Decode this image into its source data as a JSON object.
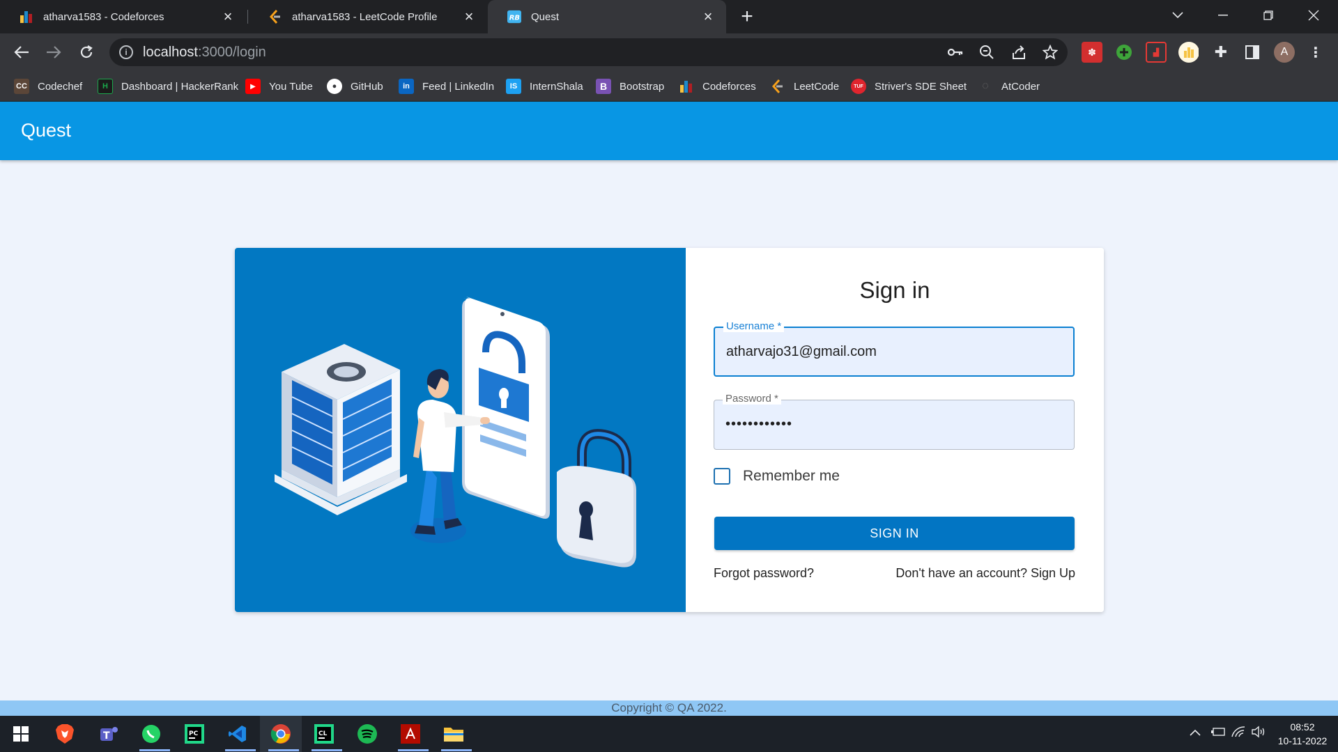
{
  "browser": {
    "tabs": [
      {
        "title": "atharva1583 - Codeforces",
        "favicon": "codeforces-icon",
        "active": false
      },
      {
        "title": "atharva1583 - LeetCode Profile",
        "favicon": "leetcode-icon",
        "active": false
      },
      {
        "title": "Quest",
        "favicon": "react-bootstrap-icon",
        "active": true
      }
    ],
    "new_tab_icon": "plus-icon",
    "url_host": "localhost",
    "url_path": ":3000/login",
    "profile_initial": "A",
    "bookmarks": [
      {
        "label": "Codechef",
        "icon": "codechef-icon",
        "color": "#5b4638",
        "glyph": "CC"
      },
      {
        "label": "Dashboard | HackerRank",
        "icon": "hackerrank-icon",
        "color": "#1ba94c",
        "glyph": "H"
      },
      {
        "label": "You Tube",
        "icon": "youtube-icon",
        "color": "#ff0000",
        "glyph": "▶"
      },
      {
        "label": "GitHub",
        "icon": "github-icon",
        "color": "#ffffff",
        "glyph": "●"
      },
      {
        "label": "Feed | LinkedIn",
        "icon": "linkedin-icon",
        "color": "#0a66c2",
        "glyph": "in"
      },
      {
        "label": "InternShala",
        "icon": "internshala-icon",
        "color": "#1da1f2",
        "glyph": "IS"
      },
      {
        "label": "Bootstrap",
        "icon": "bootstrap-icon",
        "color": "#7952b3",
        "glyph": "B"
      },
      {
        "label": "Codeforces",
        "icon": "codeforces-icon",
        "color": "#1f8acb",
        "glyph": "▮"
      },
      {
        "label": "LeetCode",
        "icon": "leetcode-icon",
        "color": "#35363a",
        "glyph": "⟨"
      },
      {
        "label": "Striver's SDE Sheet",
        "icon": "tuf-icon",
        "color": "#e0252e",
        "glyph": "TUF"
      },
      {
        "label": "AtCoder",
        "icon": "atcoder-icon",
        "color": "#35363a",
        "glyph": "◌"
      }
    ]
  },
  "app": {
    "brand": "Quest",
    "signin_title": "Sign in",
    "username_label": "Username *",
    "username_value": "atharvajo31@gmail.com",
    "password_label": "Password *",
    "password_value": "••••••••••••",
    "remember_label": "Remember me",
    "remember_checked": false,
    "signin_button": "SIGN IN",
    "forgot_link": "Forgot password?",
    "signup_link": "Don't have an account? Sign Up",
    "footer": "Copyright © QA 2022."
  },
  "taskbar": {
    "apps": [
      "windows-start-icon",
      "brave-icon",
      "teams-icon",
      "whatsapp-icon",
      "pycharm-icon",
      "vscode-icon",
      "chrome-icon",
      "clion-icon",
      "spotify-icon",
      "acrobat-icon",
      "file-explorer-icon"
    ],
    "time": "08:52",
    "date": "10-11-2022"
  },
  "colors": {
    "appbar": "#0896e4",
    "illustration_bg": "#0278c2",
    "button": "#0275c3",
    "page_bg": "#eef3fc"
  }
}
